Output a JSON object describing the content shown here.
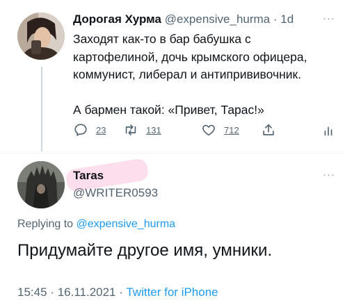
{
  "tweet1": {
    "display_name": "Дорогая Хурма",
    "handle": "@expensive_hurma",
    "separator": "·",
    "age": "1d",
    "more": "···",
    "lines": [
      "Заходят как-то в бар бабушка с",
      "картофелиной, дочь крымского офицера,",
      "коммунист, либерал и антипрививочник."
    ],
    "line_last": "А бармен такой: «Привет, Тарас!»",
    "actions": {
      "replies": "23",
      "retweets": "131",
      "likes": "712"
    }
  },
  "tweet2": {
    "display_name": "Taras",
    "handle": "@WRITER0593",
    "more": "···",
    "replying_prefix": "Replying to",
    "replying_handle": "@expensive_hurma",
    "text": "Придумайте другое имя, умники.",
    "time": "15:45",
    "date": "16.11.2021",
    "dot": "·",
    "client": "Twitter for iPhone"
  },
  "colors": {
    "link": "#1d9bf0",
    "secondary": "#536471",
    "highlight": "#f7a0c8"
  }
}
